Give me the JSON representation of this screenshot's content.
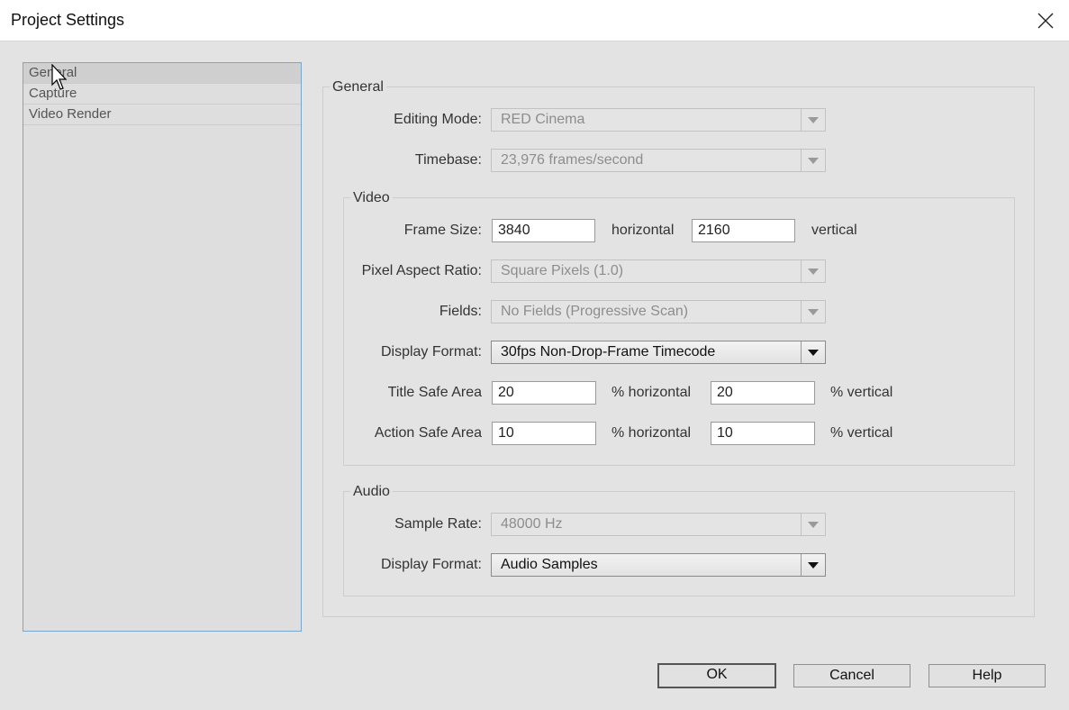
{
  "window": {
    "title": "Project Settings"
  },
  "sidebar": {
    "items": [
      {
        "label": "General"
      },
      {
        "label": "Capture"
      },
      {
        "label": "Video Render"
      }
    ]
  },
  "general": {
    "legend": "General",
    "editing_mode": {
      "label": "Editing Mode:",
      "value": "RED Cinema"
    },
    "timebase": {
      "label": "Timebase:",
      "value": "23,976 frames/second"
    }
  },
  "video": {
    "legend": "Video",
    "frame_size": {
      "label": "Frame Size:",
      "width": "3840",
      "width_unit": "horizontal",
      "height": "2160",
      "height_unit": "vertical"
    },
    "pixel_aspect": {
      "label": "Pixel Aspect Ratio:",
      "value": "Square Pixels (1.0)"
    },
    "fields": {
      "label": "Fields:",
      "value": "No Fields (Progressive Scan)"
    },
    "display_format": {
      "label": "Display Format:",
      "value": "30fps Non-Drop-Frame Timecode"
    },
    "title_safe": {
      "label": "Title Safe Area",
      "h": "20",
      "h_unit": "% horizontal",
      "v": "20",
      "v_unit": "% vertical"
    },
    "action_safe": {
      "label": "Action Safe Area",
      "h": "10",
      "h_unit": "% horizontal",
      "v": "10",
      "v_unit": "% vertical"
    }
  },
  "audio": {
    "legend": "Audio",
    "sample_rate": {
      "label": "Sample Rate:",
      "value": "48000 Hz"
    },
    "display_format": {
      "label": "Display Format:",
      "value": "Audio Samples"
    }
  },
  "buttons": {
    "ok": "OK",
    "cancel": "Cancel",
    "help": "Help"
  },
  "icons": {
    "close": "close-icon",
    "cursor": "mouse-cursor-icon",
    "dropdown": "chevron-down-icon"
  }
}
